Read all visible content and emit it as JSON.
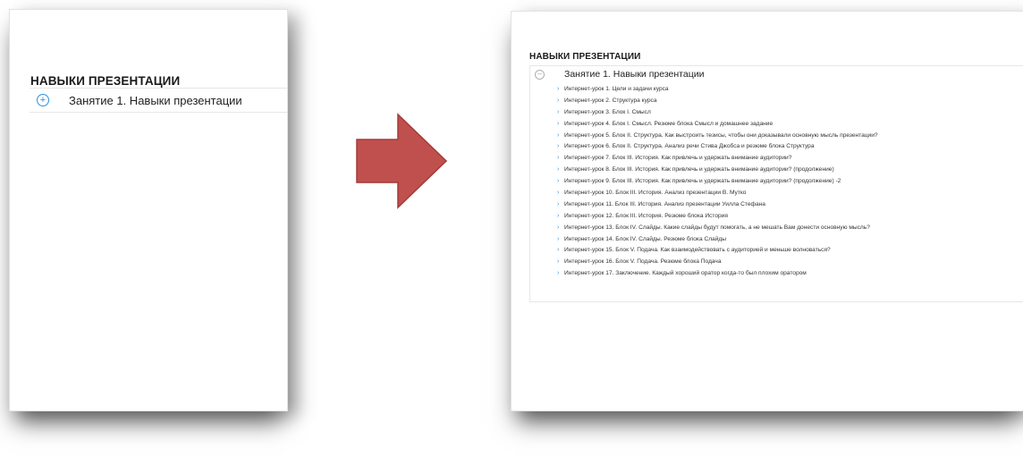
{
  "left_panel": {
    "section_title": "НАВЫКИ ПРЕЗЕНТАЦИИ",
    "lesson": {
      "title": "Занятие 1. Навыки презентации",
      "icon": "plus-circle-icon",
      "state": "collapsed"
    }
  },
  "transition": {
    "icon": "right-arrow-icon",
    "color": "#c0504d"
  },
  "right_panel": {
    "section_title": "НАВЫКИ ПРЕЗЕНТАЦИИ",
    "lesson": {
      "title": "Занятие 1. Навыки презентации",
      "icon": "minus-circle-icon",
      "state": "expanded",
      "items": [
        "Интернет-урок 1. Цели и задачи курса",
        "Интернет-урок 2. Структура курса",
        "Интернет-урок 3. Блок I. Смысл",
        "Интернет-урок 4. Блок I. Смысл. Резюме блока Смысл и домашнее задание",
        "Интернет-урок 5. Блок II. Структура. Как выстроить тезисы, чтобы они доказывали основную мысль презентации?",
        "Интернет-урок 6. Блок II. Структура. Анализ речи Стива Джобса и резюме блока Структура",
        "Интернет-урок 7. Блок III. История. Как привлечь и удержать внимание аудитории?",
        "Интернет-урок 8. Блок III. История. Как привлечь и удержать внимание аудитории? (продолжение)",
        "Интернет-урок 9. Блок III. История. Как привлечь и удержать внимание аудитории? (продолжение) -2",
        "Интернет-урок 10. Блок III. История. Анализ презентации В. Мутко",
        "Интернет-урок 11. Блок III. История. Анализ презентации Уилла Стефана",
        "Интернет-урок 12. Блок III. История. Резюме блока История",
        "Интернет-урок 13. Блок IV. Слайды. Какие слайды будут помогать, а не мешать Вам донести основную мысль?",
        "Интернет-урок 14. Блок IV. Слайды. Резюме блока Слайды",
        "Интернет-урок 15. Блок V. Подача. Как взаимодействовать с аудиторией и меньше волноваться?",
        "Интернет-урок 16. Блок V. Подача. Резюме блока Подача",
        "Интернет-урок 17. Заключение. Каждый хороший оратор когда-то был плохим оратором"
      ]
    }
  }
}
